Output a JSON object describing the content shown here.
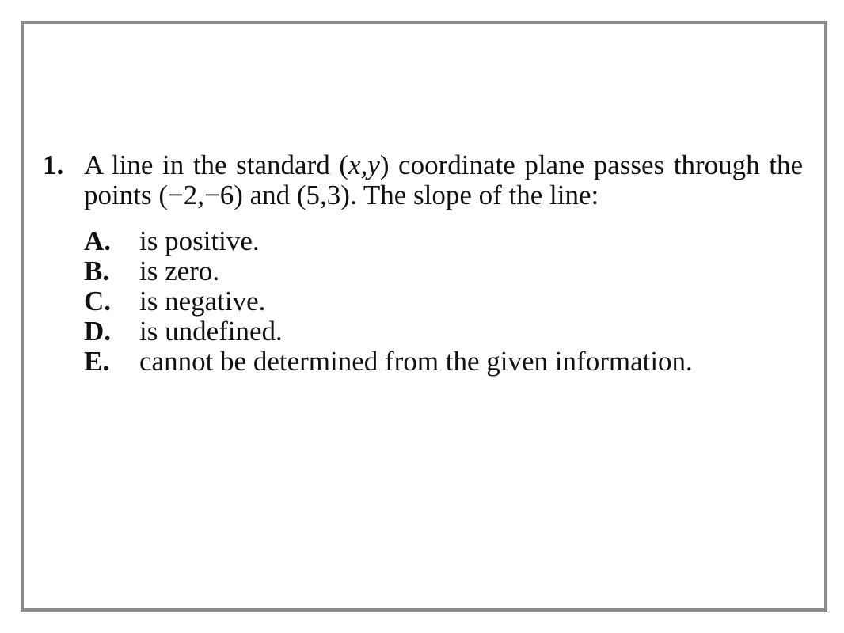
{
  "question": {
    "number": "1.",
    "stem_part1": "A line in the standard (",
    "stem_var": "x,y",
    "stem_part2": ") coordinate plane passes through the points (−2,−6) and (5,3). The slope of the line:",
    "choices": [
      {
        "letter": "A.",
        "text": "is positive."
      },
      {
        "letter": "B.",
        "text": "is zero."
      },
      {
        "letter": "C.",
        "text": "is negative."
      },
      {
        "letter": "D.",
        "text": "is undefined."
      },
      {
        "letter": "E.",
        "text": "cannot be determined from the given information."
      }
    ]
  },
  "colors": {
    "frame_border": "#8c8c8c",
    "text": "#111111",
    "background": "#ffffff"
  }
}
